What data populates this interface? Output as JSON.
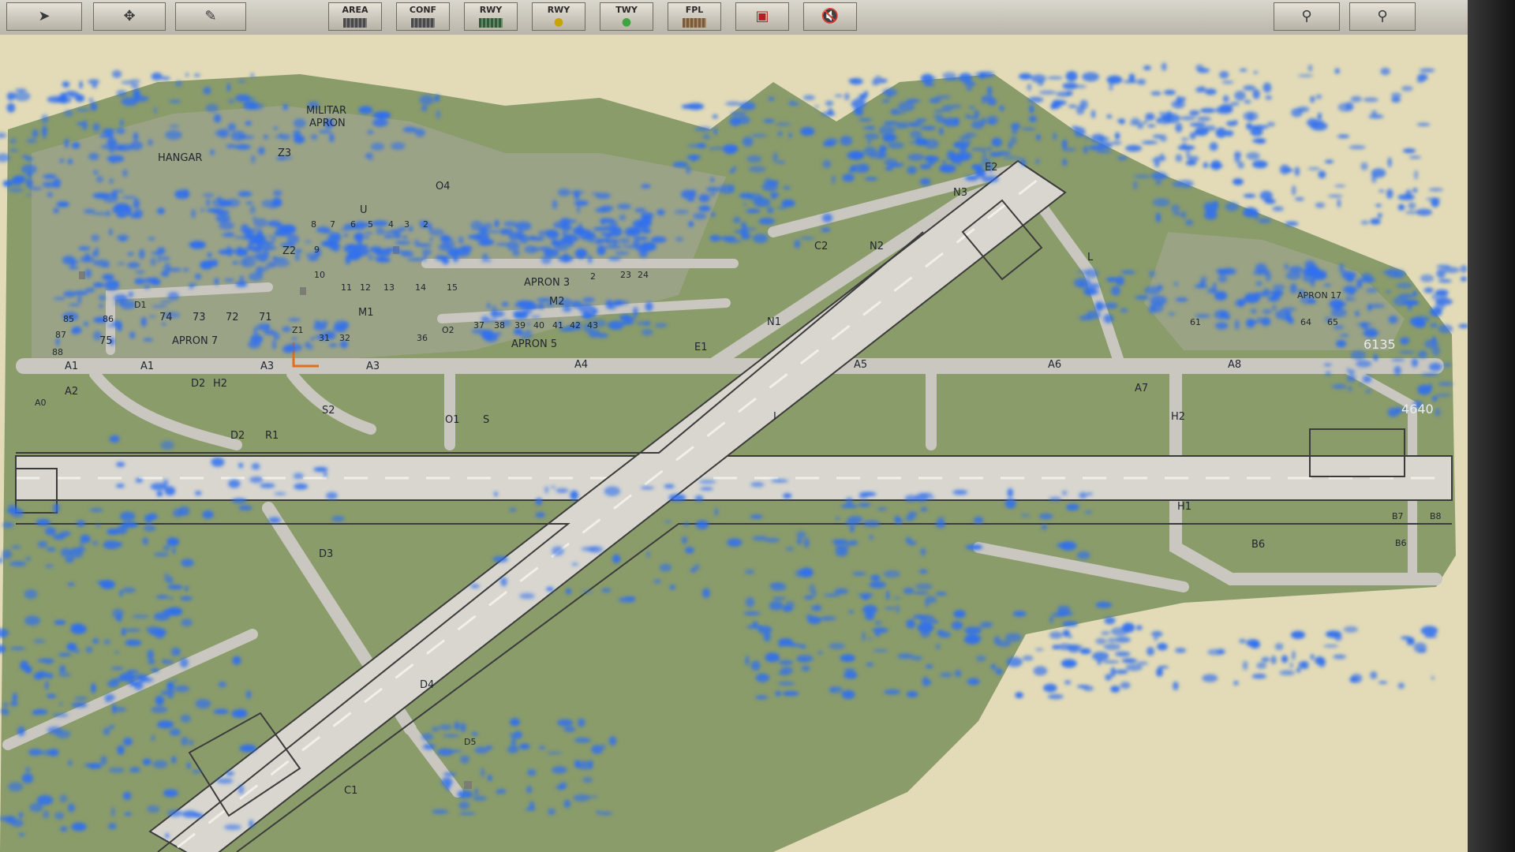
{
  "toolbar": {
    "buttons": [
      {
        "id": "cursor",
        "label": "",
        "icon": "cursor-arrow-icon"
      },
      {
        "id": "pan",
        "label": "",
        "icon": "move-arrows-icon"
      },
      {
        "id": "edit",
        "label": "",
        "icon": "pencil-icon"
      },
      {
        "id": "area",
        "label": "AREA",
        "icon": "area-layer-icon"
      },
      {
        "id": "conf",
        "label": "CONF",
        "icon": "config-layer-icon"
      },
      {
        "id": "rwy1",
        "label": "RWY",
        "icon": "runway-layer-icon"
      },
      {
        "id": "rwy2",
        "label": "RWY",
        "icon": "runway-light-icon"
      },
      {
        "id": "twy",
        "label": "TWY",
        "icon": "taxiway-light-icon"
      },
      {
        "id": "fpl",
        "label": "FPL",
        "icon": "flight-plan-icon"
      },
      {
        "id": "cd",
        "label": "",
        "icon": "alert-display-icon"
      },
      {
        "id": "mute",
        "label": "",
        "icon": "speaker-mute-icon"
      },
      {
        "id": "zoom1",
        "label": "",
        "icon": "magnifier-icon"
      },
      {
        "id": "zoom2",
        "label": "",
        "icon": "magnifier-icon"
      }
    ]
  },
  "map": {
    "colors": {
      "background": "#e3dbb7",
      "grass": "#8b9c6b",
      "pavement": "#c9c7c0",
      "weather": "#2e6ff0",
      "text": "#1f2630"
    },
    "labels": [
      {
        "t": "MILITAR"
      },
      {
        "t": "APRON"
      },
      {
        "t": "HANGAR"
      },
      {
        "t": "Z3"
      },
      {
        "t": "O4"
      },
      {
        "t": "U"
      },
      {
        "t": "8"
      },
      {
        "t": "7"
      },
      {
        "t": "6"
      },
      {
        "t": "5"
      },
      {
        "t": "4"
      },
      {
        "t": "3"
      },
      {
        "t": "2"
      },
      {
        "t": "Z2"
      },
      {
        "t": "9"
      },
      {
        "t": "10"
      },
      {
        "t": "11"
      },
      {
        "t": "12"
      },
      {
        "t": "13"
      },
      {
        "t": "14"
      },
      {
        "t": "15"
      },
      {
        "t": "APRON 3"
      },
      {
        "t": "2"
      },
      {
        "t": "23"
      },
      {
        "t": "24"
      },
      {
        "t": "D1"
      },
      {
        "t": "74"
      },
      {
        "t": "73"
      },
      {
        "t": "72"
      },
      {
        "t": "71"
      },
      {
        "t": "M1"
      },
      {
        "t": "M2"
      },
      {
        "t": "Z1"
      },
      {
        "t": "31"
      },
      {
        "t": "32"
      },
      {
        "t": "36"
      },
      {
        "t": "O2"
      },
      {
        "t": "37"
      },
      {
        "t": "38"
      },
      {
        "t": "39"
      },
      {
        "t": "40"
      },
      {
        "t": "41"
      },
      {
        "t": "42"
      },
      {
        "t": "43"
      },
      {
        "t": "APRON 5"
      },
      {
        "t": "75"
      },
      {
        "t": "APRON 7"
      },
      {
        "t": "85"
      },
      {
        "t": "86"
      },
      {
        "t": "87"
      },
      {
        "t": "88"
      },
      {
        "t": "A1"
      },
      {
        "t": "A1"
      },
      {
        "t": "A2"
      },
      {
        "t": "A0"
      },
      {
        "t": "A3"
      },
      {
        "t": "A3"
      },
      {
        "t": "A4"
      },
      {
        "t": "A5"
      },
      {
        "t": "A6"
      },
      {
        "t": "A7"
      },
      {
        "t": "A8"
      },
      {
        "t": "D2"
      },
      {
        "t": "H2"
      },
      {
        "t": "S2"
      },
      {
        "t": "O1"
      },
      {
        "t": "S"
      },
      {
        "t": "D2"
      },
      {
        "t": "R1"
      },
      {
        "t": "E1"
      },
      {
        "t": "N1"
      },
      {
        "t": "E2"
      },
      {
        "t": "N3"
      },
      {
        "t": "C2"
      },
      {
        "t": "N2"
      },
      {
        "t": "L"
      },
      {
        "t": "APRON 17"
      },
      {
        "t": "61"
      },
      {
        "t": "64"
      },
      {
        "t": "65"
      },
      {
        "t": "6135"
      },
      {
        "t": "4640"
      },
      {
        "t": "H2"
      },
      {
        "t": "H1"
      },
      {
        "t": "B6"
      },
      {
        "t": "B7"
      },
      {
        "t": "B8"
      },
      {
        "t": "B6"
      },
      {
        "t": "D3"
      },
      {
        "t": "D4"
      },
      {
        "t": "D5"
      },
      {
        "t": "C1"
      },
      {
        "t": "I"
      }
    ]
  }
}
